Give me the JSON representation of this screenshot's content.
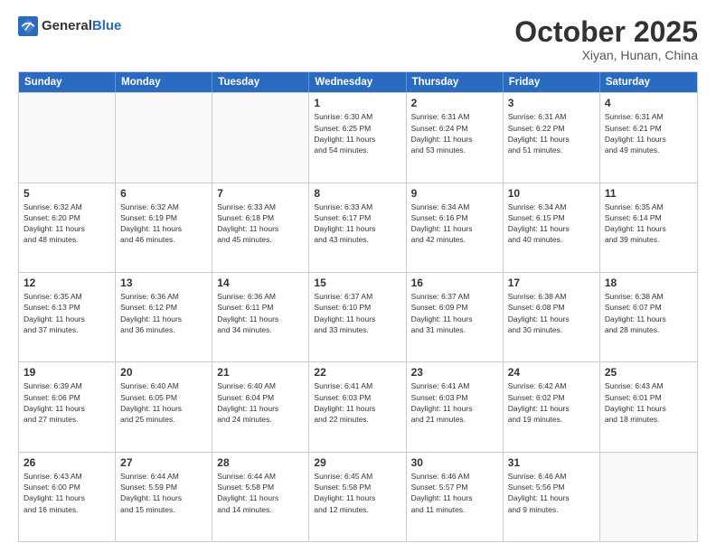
{
  "header": {
    "logo": {
      "general": "General",
      "blue": "Blue"
    },
    "month": "October 2025",
    "location": "Xiyan, Hunan, China"
  },
  "weekdays": [
    "Sunday",
    "Monday",
    "Tuesday",
    "Wednesday",
    "Thursday",
    "Friday",
    "Saturday"
  ],
  "rows": [
    [
      {
        "day": "",
        "lines": []
      },
      {
        "day": "",
        "lines": []
      },
      {
        "day": "",
        "lines": []
      },
      {
        "day": "1",
        "lines": [
          "Sunrise: 6:30 AM",
          "Sunset: 6:25 PM",
          "Daylight: 11 hours",
          "and 54 minutes."
        ]
      },
      {
        "day": "2",
        "lines": [
          "Sunrise: 6:31 AM",
          "Sunset: 6:24 PM",
          "Daylight: 11 hours",
          "and 53 minutes."
        ]
      },
      {
        "day": "3",
        "lines": [
          "Sunrise: 6:31 AM",
          "Sunset: 6:22 PM",
          "Daylight: 11 hours",
          "and 51 minutes."
        ]
      },
      {
        "day": "4",
        "lines": [
          "Sunrise: 6:31 AM",
          "Sunset: 6:21 PM",
          "Daylight: 11 hours",
          "and 49 minutes."
        ]
      }
    ],
    [
      {
        "day": "5",
        "lines": [
          "Sunrise: 6:32 AM",
          "Sunset: 6:20 PM",
          "Daylight: 11 hours",
          "and 48 minutes."
        ]
      },
      {
        "day": "6",
        "lines": [
          "Sunrise: 6:32 AM",
          "Sunset: 6:19 PM",
          "Daylight: 11 hours",
          "and 46 minutes."
        ]
      },
      {
        "day": "7",
        "lines": [
          "Sunrise: 6:33 AM",
          "Sunset: 6:18 PM",
          "Daylight: 11 hours",
          "and 45 minutes."
        ]
      },
      {
        "day": "8",
        "lines": [
          "Sunrise: 6:33 AM",
          "Sunset: 6:17 PM",
          "Daylight: 11 hours",
          "and 43 minutes."
        ]
      },
      {
        "day": "9",
        "lines": [
          "Sunrise: 6:34 AM",
          "Sunset: 6:16 PM",
          "Daylight: 11 hours",
          "and 42 minutes."
        ]
      },
      {
        "day": "10",
        "lines": [
          "Sunrise: 6:34 AM",
          "Sunset: 6:15 PM",
          "Daylight: 11 hours",
          "and 40 minutes."
        ]
      },
      {
        "day": "11",
        "lines": [
          "Sunrise: 6:35 AM",
          "Sunset: 6:14 PM",
          "Daylight: 11 hours",
          "and 39 minutes."
        ]
      }
    ],
    [
      {
        "day": "12",
        "lines": [
          "Sunrise: 6:35 AM",
          "Sunset: 6:13 PM",
          "Daylight: 11 hours",
          "and 37 minutes."
        ]
      },
      {
        "day": "13",
        "lines": [
          "Sunrise: 6:36 AM",
          "Sunset: 6:12 PM",
          "Daylight: 11 hours",
          "and 36 minutes."
        ]
      },
      {
        "day": "14",
        "lines": [
          "Sunrise: 6:36 AM",
          "Sunset: 6:11 PM",
          "Daylight: 11 hours",
          "and 34 minutes."
        ]
      },
      {
        "day": "15",
        "lines": [
          "Sunrise: 6:37 AM",
          "Sunset: 6:10 PM",
          "Daylight: 11 hours",
          "and 33 minutes."
        ]
      },
      {
        "day": "16",
        "lines": [
          "Sunrise: 6:37 AM",
          "Sunset: 6:09 PM",
          "Daylight: 11 hours",
          "and 31 minutes."
        ]
      },
      {
        "day": "17",
        "lines": [
          "Sunrise: 6:38 AM",
          "Sunset: 6:08 PM",
          "Daylight: 11 hours",
          "and 30 minutes."
        ]
      },
      {
        "day": "18",
        "lines": [
          "Sunrise: 6:38 AM",
          "Sunset: 6:07 PM",
          "Daylight: 11 hours",
          "and 28 minutes."
        ]
      }
    ],
    [
      {
        "day": "19",
        "lines": [
          "Sunrise: 6:39 AM",
          "Sunset: 6:06 PM",
          "Daylight: 11 hours",
          "and 27 minutes."
        ]
      },
      {
        "day": "20",
        "lines": [
          "Sunrise: 6:40 AM",
          "Sunset: 6:05 PM",
          "Daylight: 11 hours",
          "and 25 minutes."
        ]
      },
      {
        "day": "21",
        "lines": [
          "Sunrise: 6:40 AM",
          "Sunset: 6:04 PM",
          "Daylight: 11 hours",
          "and 24 minutes."
        ]
      },
      {
        "day": "22",
        "lines": [
          "Sunrise: 6:41 AM",
          "Sunset: 6:03 PM",
          "Daylight: 11 hours",
          "and 22 minutes."
        ]
      },
      {
        "day": "23",
        "lines": [
          "Sunrise: 6:41 AM",
          "Sunset: 6:03 PM",
          "Daylight: 11 hours",
          "and 21 minutes."
        ]
      },
      {
        "day": "24",
        "lines": [
          "Sunrise: 6:42 AM",
          "Sunset: 6:02 PM",
          "Daylight: 11 hours",
          "and 19 minutes."
        ]
      },
      {
        "day": "25",
        "lines": [
          "Sunrise: 6:43 AM",
          "Sunset: 6:01 PM",
          "Daylight: 11 hours",
          "and 18 minutes."
        ]
      }
    ],
    [
      {
        "day": "26",
        "lines": [
          "Sunrise: 6:43 AM",
          "Sunset: 6:00 PM",
          "Daylight: 11 hours",
          "and 16 minutes."
        ]
      },
      {
        "day": "27",
        "lines": [
          "Sunrise: 6:44 AM",
          "Sunset: 5:59 PM",
          "Daylight: 11 hours",
          "and 15 minutes."
        ]
      },
      {
        "day": "28",
        "lines": [
          "Sunrise: 6:44 AM",
          "Sunset: 5:58 PM",
          "Daylight: 11 hours",
          "and 14 minutes."
        ]
      },
      {
        "day": "29",
        "lines": [
          "Sunrise: 6:45 AM",
          "Sunset: 5:58 PM",
          "Daylight: 11 hours",
          "and 12 minutes."
        ]
      },
      {
        "day": "30",
        "lines": [
          "Sunrise: 6:46 AM",
          "Sunset: 5:57 PM",
          "Daylight: 11 hours",
          "and 11 minutes."
        ]
      },
      {
        "day": "31",
        "lines": [
          "Sunrise: 6:46 AM",
          "Sunset: 5:56 PM",
          "Daylight: 11 hours",
          "and 9 minutes."
        ]
      },
      {
        "day": "",
        "lines": []
      }
    ]
  ]
}
